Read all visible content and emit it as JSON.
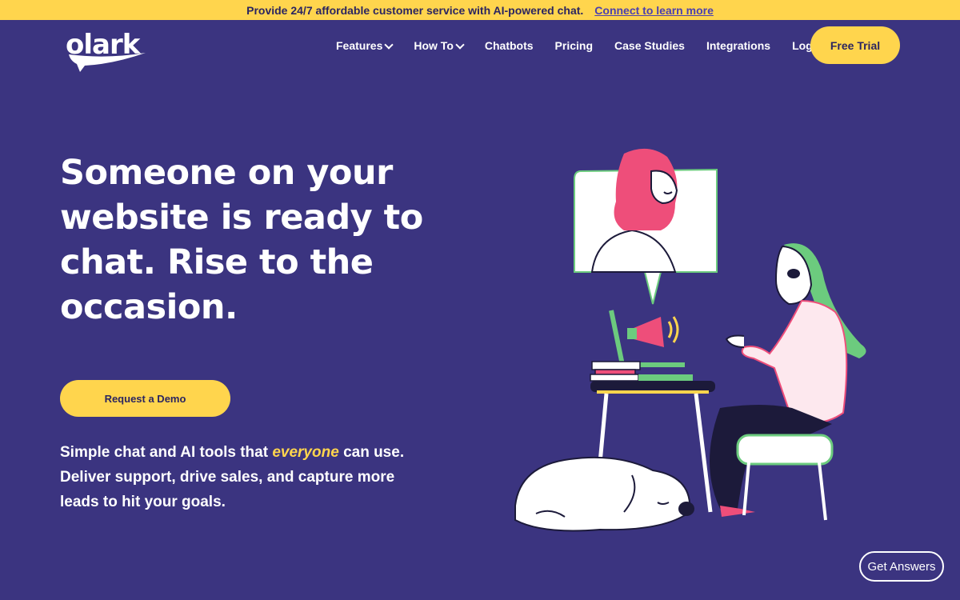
{
  "announcement": {
    "message": "Provide 24/7 affordable customer service with AI-powered chat.",
    "link": "Connect to learn more"
  },
  "brand": {
    "logo_text": "olark"
  },
  "nav": {
    "items": [
      {
        "label": "Features",
        "has_dropdown": true
      },
      {
        "label": "How To",
        "has_dropdown": true
      },
      {
        "label": "Chatbots",
        "has_dropdown": false
      },
      {
        "label": "Pricing",
        "has_dropdown": false
      },
      {
        "label": "Case Studies",
        "has_dropdown": false
      },
      {
        "label": "Integrations",
        "has_dropdown": false
      },
      {
        "label": "Log in",
        "has_dropdown": false
      }
    ],
    "cta": "Free Trial"
  },
  "hero": {
    "title": "Someone on your website is ready to chat. Rise to the occasion.",
    "demo_button": "Request a Demo",
    "subtitle_before": "Simple chat and AI tools that",
    "subtitle_emphasis": "everyone",
    "subtitle_after": "can use. Deliver support, drive sales, and capture more leads to hit your goals."
  },
  "help_widget": {
    "label": "Get Answers"
  },
  "colors": {
    "background": "#3b3480",
    "accent": "#ffd54d",
    "pink": "#ee4e7a",
    "green": "#6ccb7e"
  },
  "icons": [
    "chevron-down-icon",
    "speech-tail-icon"
  ]
}
